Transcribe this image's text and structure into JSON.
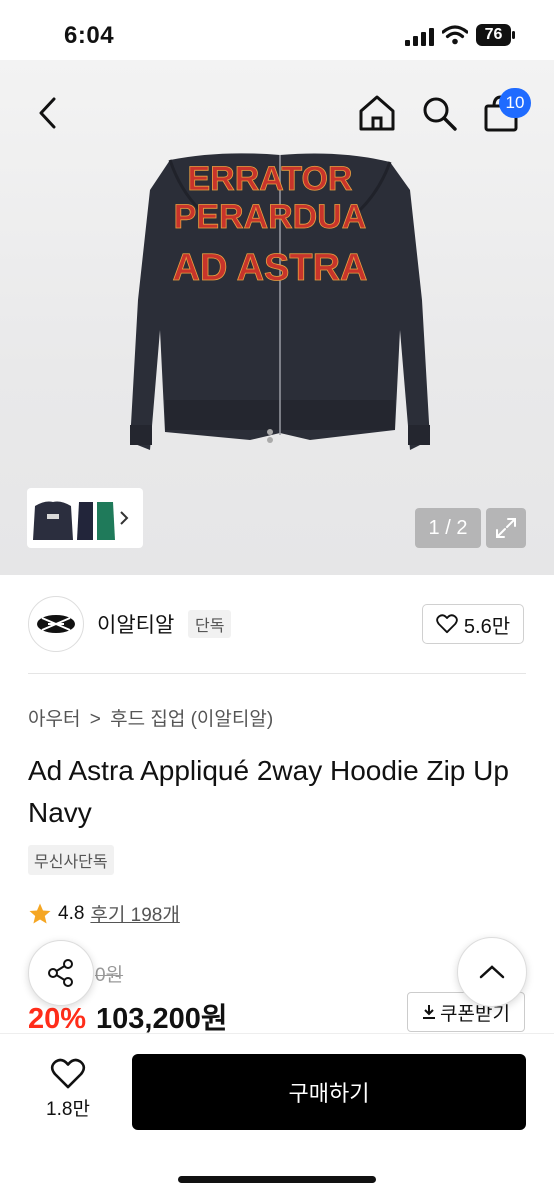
{
  "status_bar": {
    "time": "6:04",
    "battery": "76"
  },
  "header": {
    "cart_count": "10"
  },
  "gallery": {
    "counter": "1 / 2",
    "print_lines": [
      "ERRATOR",
      "PERARDUA",
      "AD ASTRA"
    ]
  },
  "brand": {
    "name": "이알티알",
    "tag": "단독",
    "likes": "5.6만"
  },
  "breadcrumb": {
    "category": "아우터",
    "separator": ">",
    "subcategory": "후드 집업 (이알티알)"
  },
  "product": {
    "title": "Ad Astra Appliqué 2way Hoodie Zip Up Navy",
    "store_tag": "무신사단독",
    "rating": "4.8",
    "reviews": "후기 198개",
    "original_price": "0원",
    "discount": "20%",
    "price": "103,200원",
    "coupon_label": "쿠폰받기"
  },
  "bottom_bar": {
    "like_count": "1.8만",
    "buy_label": "구매하기"
  },
  "colors": {
    "accent": "#1f6bff",
    "discount": "#ff2d1a",
    "star": "#f5a623",
    "buy_button": "#000000"
  }
}
